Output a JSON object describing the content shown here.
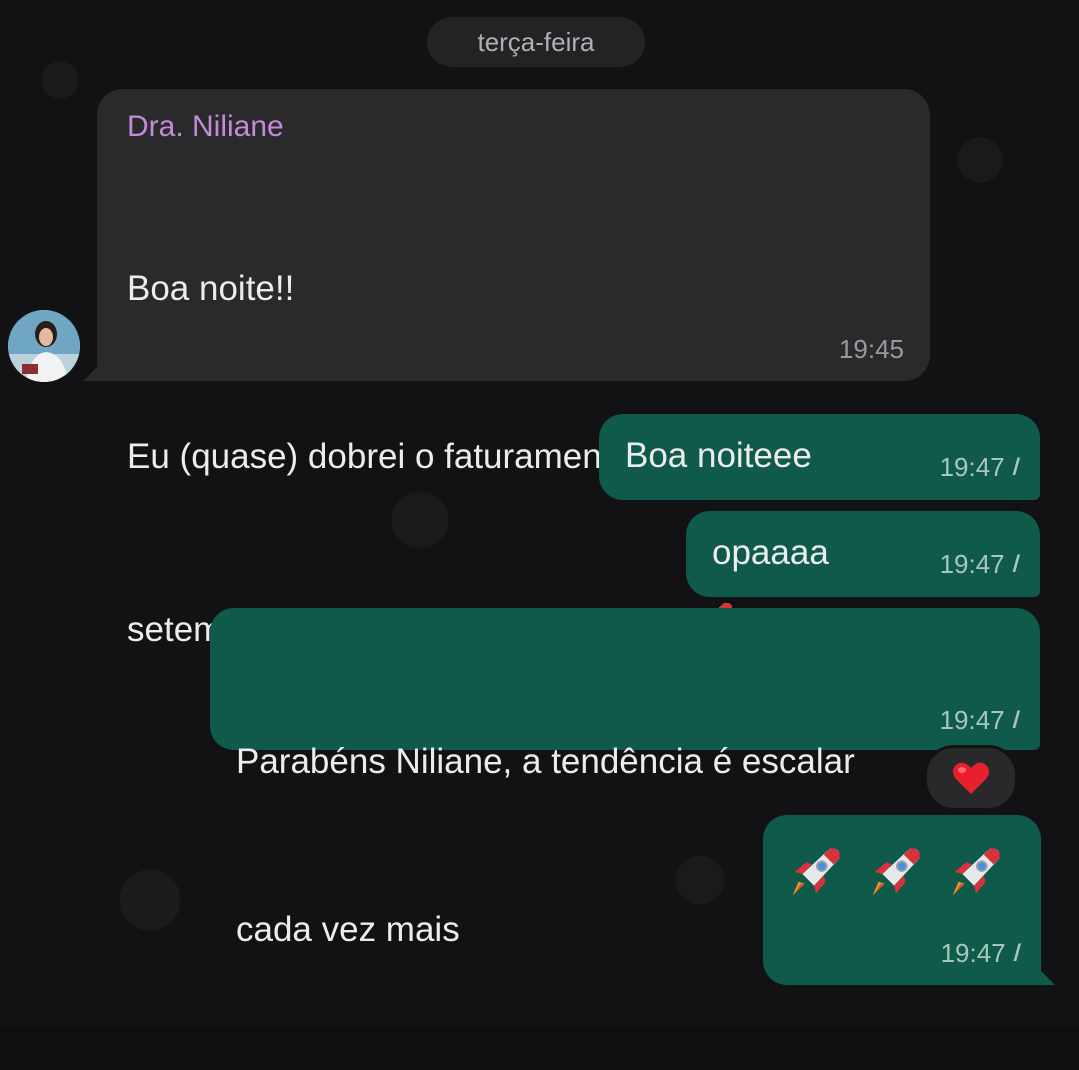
{
  "date_separator": "terça-feira",
  "incoming_message": {
    "sender": "Dra. Niliane",
    "lines": [
      "Boa noite!!",
      "Eu (quase) dobrei o faturamento em",
      "setembro, comparando com agosto"
    ],
    "emoji": "rocket",
    "time": "19:45"
  },
  "outgoing_messages": [
    {
      "text": "Boa noiteee",
      "time": "19:47"
    },
    {
      "text": "opaaaa",
      "time": "19:47"
    },
    {
      "lines": [
        "Parabéns Niliane, a tendência é escalar",
        "cada vez mais"
      ],
      "time": "19:47",
      "reaction": "red-heart"
    },
    {
      "emojis": [
        "rocket",
        "rocket",
        "rocket"
      ],
      "time": "19:47"
    }
  ],
  "colors": {
    "incoming_bubble": "#2a2a2d",
    "outgoing_bubble": "#0f5a4a",
    "sender_name": "#c38ad8",
    "read_ticks": "#a7c7bd"
  }
}
